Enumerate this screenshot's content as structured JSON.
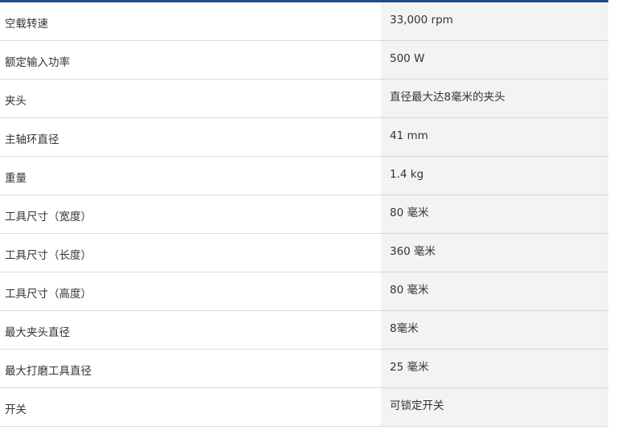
{
  "specs": [
    {
      "label": "空载转速",
      "value": "33,000 rpm"
    },
    {
      "label": "额定输入功率",
      "value": "500 W"
    },
    {
      "label": "夹头",
      "value": "直径最大达8毫米的夹头"
    },
    {
      "label": "主轴环直径",
      "value": "41 mm"
    },
    {
      "label": "重量",
      "value": "1.4 kg"
    },
    {
      "label": "工具尺寸（宽度）",
      "value": "80 毫米"
    },
    {
      "label": "工具尺寸（长度）",
      "value": "360 毫米"
    },
    {
      "label": "工具尺寸（高度）",
      "value": "80 毫米"
    },
    {
      "label": "最大夹头直径",
      "value": "8毫米"
    },
    {
      "label": "最大打磨工具直径",
      "value": "25 毫米"
    },
    {
      "label": "开关",
      "value": "可锁定开关"
    }
  ]
}
